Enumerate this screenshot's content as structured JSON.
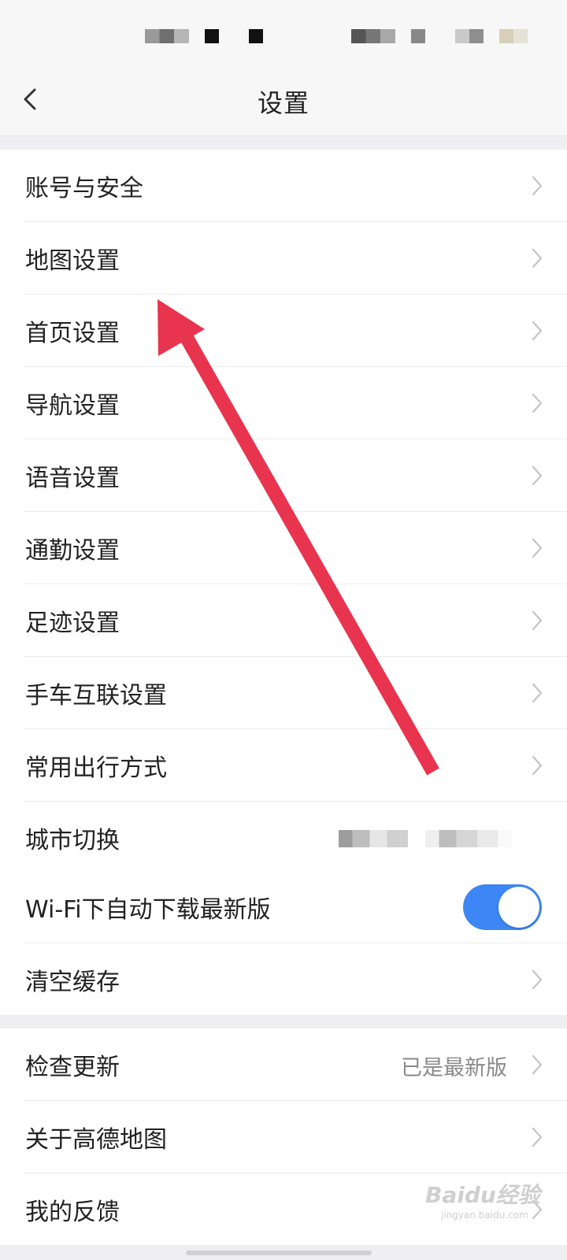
{
  "header": {
    "title": "设置"
  },
  "groups": {
    "main": [
      {
        "label": "账号与安全"
      },
      {
        "label": "地图设置"
      },
      {
        "label": "首页设置"
      },
      {
        "label": "导航设置"
      },
      {
        "label": "语音设置"
      },
      {
        "label": "通勤设置"
      },
      {
        "label": "足迹设置"
      },
      {
        "label": "手车互联设置"
      },
      {
        "label": "常用出行方式"
      },
      {
        "label": "城市切换",
        "value_obscured": true
      }
    ],
    "download": [
      {
        "label": "Wi-Fi下自动下载最新版",
        "toggle_on": true
      },
      {
        "label": "清空缓存"
      }
    ],
    "about": [
      {
        "label": "检查更新",
        "value": "已是最新版"
      },
      {
        "label": "关于高德地图"
      },
      {
        "label": "我的反馈"
      }
    ]
  },
  "watermark": {
    "main": "Baidu经验",
    "sub": "jingyan.baidu.com"
  },
  "colors": {
    "toggle_on": "#3d86f5",
    "annotation_arrow": "#e8344e"
  }
}
